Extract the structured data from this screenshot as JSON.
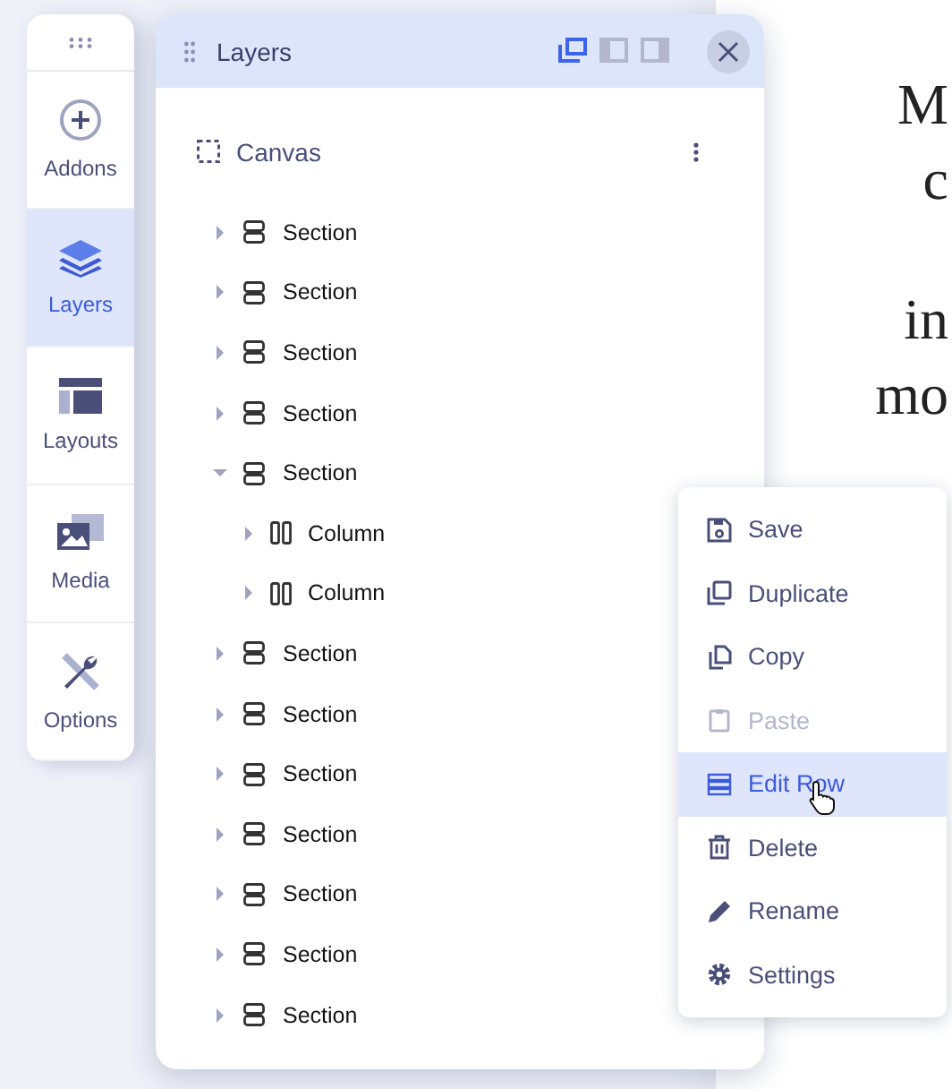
{
  "sidebar": {
    "items": [
      {
        "label": "Addons",
        "selected": false
      },
      {
        "label": "Layers",
        "selected": true
      },
      {
        "label": "Layouts",
        "selected": false
      },
      {
        "label": "Media",
        "selected": false
      },
      {
        "label": "Options",
        "selected": false
      }
    ]
  },
  "panel": {
    "title": "Layers",
    "view_modes": [
      {
        "selected": true
      },
      {
        "selected": false
      },
      {
        "selected": false
      }
    ],
    "root": "Canvas",
    "tree": [
      {
        "label": "Section",
        "expanded": false
      },
      {
        "label": "Section",
        "expanded": false
      },
      {
        "label": "Section",
        "expanded": false
      },
      {
        "label": "Section",
        "expanded": false
      },
      {
        "label": "Section",
        "expanded": true,
        "children": [
          {
            "label": "Column",
            "expanded": false
          },
          {
            "label": "Column",
            "expanded": false
          }
        ]
      },
      {
        "label": "Section",
        "expanded": false
      },
      {
        "label": "Section",
        "expanded": false
      },
      {
        "label": "Section",
        "expanded": false
      },
      {
        "label": "Section",
        "expanded": false
      },
      {
        "label": "Section",
        "expanded": false
      },
      {
        "label": "Section",
        "expanded": false
      },
      {
        "label": "Section",
        "expanded": false
      }
    ]
  },
  "context_menu": {
    "items": [
      {
        "label": "Save",
        "disabled": false,
        "selected": false
      },
      {
        "label": "Duplicate",
        "disabled": false,
        "selected": false
      },
      {
        "label": "Copy",
        "disabled": false,
        "selected": false
      },
      {
        "label": "Paste",
        "disabled": true,
        "selected": false
      },
      {
        "label": "Edit Row",
        "disabled": false,
        "selected": true
      },
      {
        "label": "Delete",
        "disabled": false,
        "selected": false
      },
      {
        "label": "Rename",
        "disabled": false,
        "selected": false
      },
      {
        "label": "Settings",
        "disabled": false,
        "selected": false
      }
    ]
  },
  "page_text": [
    "M",
    "c",
    "in",
    "mo"
  ]
}
